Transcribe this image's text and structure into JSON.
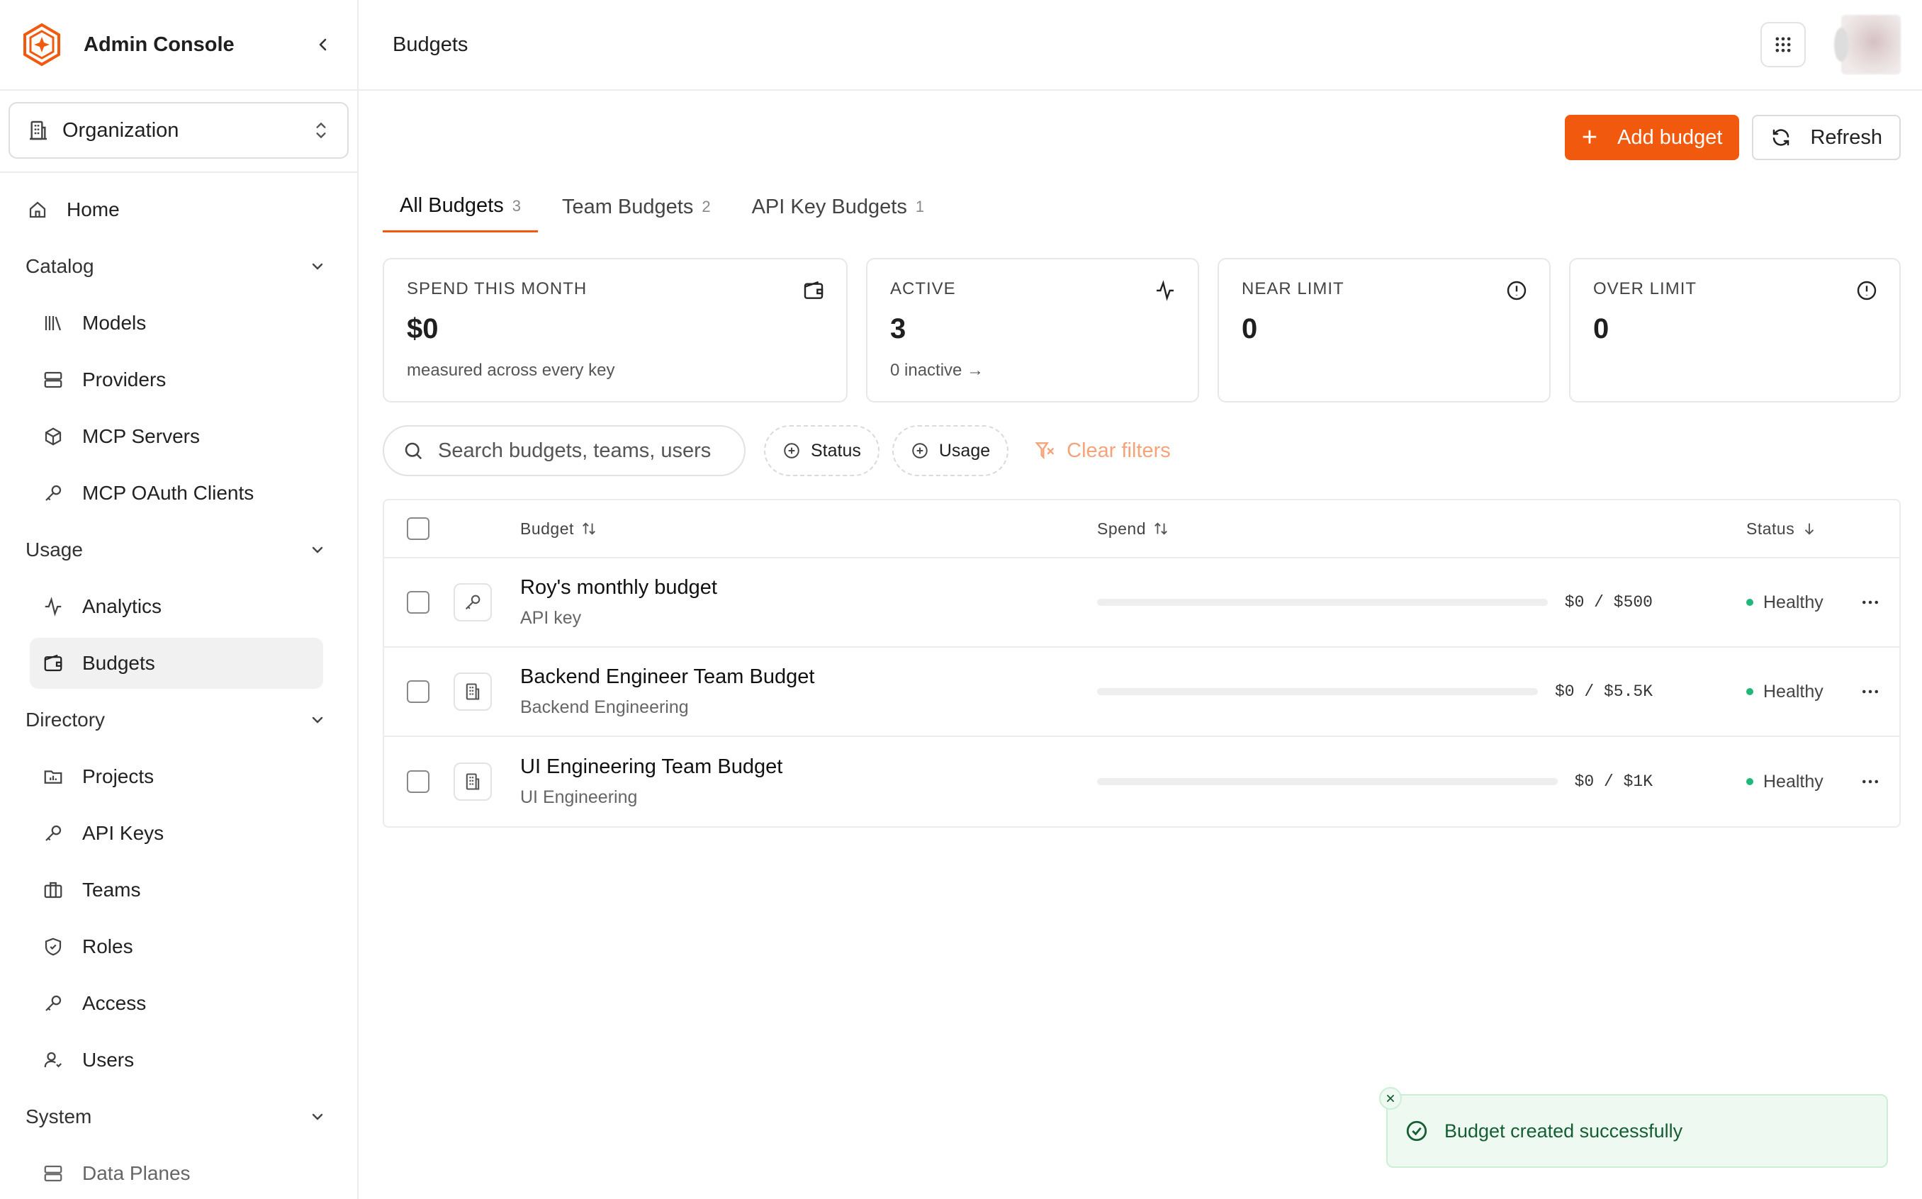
{
  "app": {
    "title": "Admin Console"
  },
  "org": {
    "label": "Organization"
  },
  "sidebar": {
    "home": "Home",
    "catalog": {
      "label": "Catalog",
      "items": [
        "Models",
        "Providers",
        "MCP Servers",
        "MCP OAuth Clients"
      ]
    },
    "usage": {
      "label": "Usage",
      "items": [
        "Analytics",
        "Budgets"
      ]
    },
    "directory": {
      "label": "Directory",
      "items": [
        "Projects",
        "API Keys",
        "Teams",
        "Roles",
        "Access",
        "Users"
      ]
    },
    "system": {
      "label": "System",
      "items": [
        "Data Planes"
      ]
    },
    "active_item": "Budgets"
  },
  "header": {
    "title": "Budgets"
  },
  "toolbar": {
    "add_label": "Add budget",
    "refresh_label": "Refresh"
  },
  "tabs": [
    {
      "label": "All Budgets",
      "count": "3"
    },
    {
      "label": "Team Budgets",
      "count": "2"
    },
    {
      "label": "API Key Budgets",
      "count": "1"
    }
  ],
  "stats": [
    {
      "label": "SPEND THIS MONTH",
      "value": "$0",
      "sub": "measured across every key"
    },
    {
      "label": "ACTIVE",
      "value": "3",
      "sub": "0 inactive →"
    },
    {
      "label": "NEAR LIMIT",
      "value": "0",
      "sub": ""
    },
    {
      "label": "OVER LIMIT",
      "value": "0",
      "sub": ""
    }
  ],
  "filters": {
    "search_placeholder": "Search budgets, teams, users",
    "status_label": "Status",
    "usage_label": "Usage",
    "clear_label": "Clear filters"
  },
  "table": {
    "headers": {
      "budget": "Budget",
      "spend": "Spend",
      "status": "Status"
    },
    "rows": [
      {
        "name": "Roy's monthly budget",
        "sub": "API key",
        "spend": "$0 / $500",
        "progress": 0,
        "status": "Healthy"
      },
      {
        "name": "Backend Engineer Team Budget",
        "sub": "Backend Engineering",
        "spend": "$0 / $5.5K",
        "progress": 0,
        "status": "Healthy"
      },
      {
        "name": "UI Engineering Team Budget",
        "sub": "UI Engineering",
        "spend": "$0 / $1K",
        "progress": 0,
        "status": "Healthy"
      }
    ]
  },
  "toast": {
    "message": "Budget created successfully"
  },
  "colors": {
    "accent": "#f15a0e",
    "success": "#1fb87a"
  }
}
